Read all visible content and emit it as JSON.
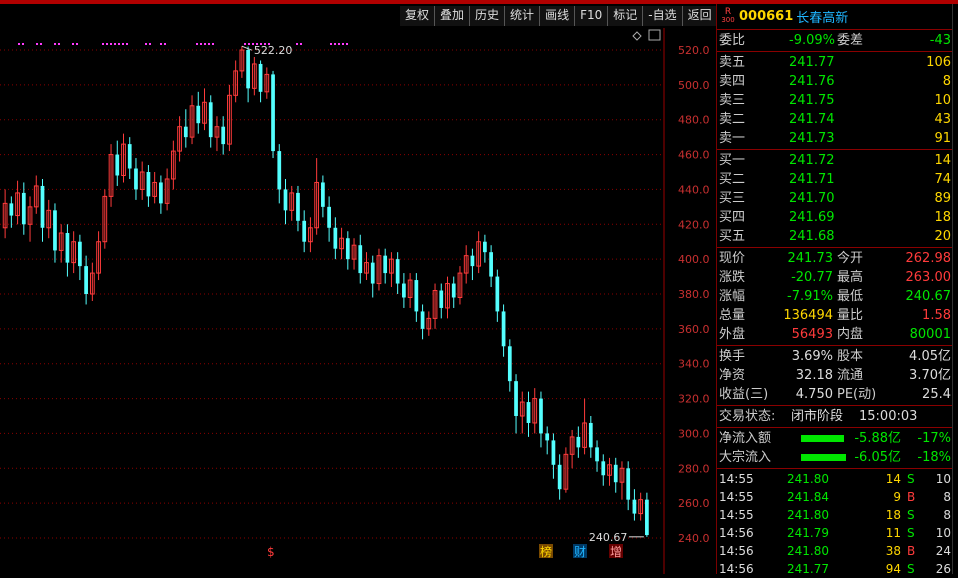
{
  "toolbar": [
    {
      "label": "复权"
    },
    {
      "label": "叠加"
    },
    {
      "label": "历史"
    },
    {
      "label": "统计"
    },
    {
      "label": "画线"
    },
    {
      "label": "F10"
    },
    {
      "label": "标记"
    },
    {
      "label": "-自选"
    },
    {
      "label": "返回"
    }
  ],
  "stock": {
    "badge_top": "R",
    "badge_bottom": "300",
    "code": "000661",
    "name": "长春高新"
  },
  "weibi": {
    "label": "委比",
    "value": "-9.09%",
    "label2": "委差",
    "value2": "-43"
  },
  "asks": [
    {
      "label": "卖五",
      "price": "241.77",
      "vol": "106"
    },
    {
      "label": "卖四",
      "price": "241.76",
      "vol": "8"
    },
    {
      "label": "卖三",
      "price": "241.75",
      "vol": "10"
    },
    {
      "label": "卖二",
      "price": "241.74",
      "vol": "43"
    },
    {
      "label": "卖一",
      "price": "241.73",
      "vol": "91"
    }
  ],
  "bids": [
    {
      "label": "买一",
      "price": "241.72",
      "vol": "14"
    },
    {
      "label": "买二",
      "price": "241.71",
      "vol": "74"
    },
    {
      "label": "买三",
      "price": "241.70",
      "vol": "89"
    },
    {
      "label": "买四",
      "price": "241.69",
      "vol": "18"
    },
    {
      "label": "买五",
      "price": "241.68",
      "vol": "20"
    }
  ],
  "quote": [
    {
      "l1": "现价",
      "v1": "241.73",
      "l2": "今开",
      "v2": "262.98"
    },
    {
      "l1": "涨跌",
      "v1": "-20.77",
      "l2": "最高",
      "v2": "263.00"
    },
    {
      "l1": "涨幅",
      "v1": "-7.91%",
      "l2": "最低",
      "v2": "240.67"
    },
    {
      "l1": "总量",
      "v1": "136494",
      "l2": "量比",
      "v2": "1.58"
    },
    {
      "l1": "外盘",
      "v1": "56493",
      "l2": "内盘",
      "v2": "80001"
    }
  ],
  "fundamentals": [
    {
      "l1": "换手",
      "v1": "3.69%",
      "l2": "股本",
      "v2": "4.05亿"
    },
    {
      "l1": "净资",
      "v1": "32.18",
      "l2": "流通",
      "v2": "3.70亿"
    },
    {
      "l1": "收益(三)",
      "v1": "4.750",
      "l2": "PE(动)",
      "v2": "25.4"
    }
  ],
  "status": {
    "label": "交易状态:",
    "phase": "闭市阶段",
    "time": "15:00:03"
  },
  "flows": [
    {
      "label": "净流入额",
      "amount": "-5.88亿",
      "pct": "-17%",
      "bar": 0.17
    },
    {
      "label": "大宗流入",
      "amount": "-6.05亿",
      "pct": "-18%",
      "bar": 0.18
    }
  ],
  "ticks": [
    {
      "time": "14:55",
      "price": "241.80",
      "vol": "14",
      "side": "S",
      "num": "10"
    },
    {
      "time": "14:55",
      "price": "241.84",
      "vol": "9",
      "side": "B",
      "num": "8"
    },
    {
      "time": "14:55",
      "price": "241.80",
      "vol": "18",
      "side": "S",
      "num": "8"
    },
    {
      "time": "14:56",
      "price": "241.79",
      "vol": "11",
      "side": "S",
      "num": "10"
    },
    {
      "time": "14:56",
      "price": "241.80",
      "vol": "38",
      "side": "B",
      "num": "24"
    },
    {
      "time": "14:56",
      "price": "241.77",
      "vol": "94",
      "side": "S",
      "num": "26"
    }
  ],
  "chart_data": {
    "type": "candlestick",
    "y_ticks": [
      "520.0",
      "500.0",
      "480.0",
      "460.0",
      "440.0",
      "420.0",
      "400.0",
      "380.0",
      "360.0",
      "340.0",
      "320.0",
      "300.0",
      "280.0",
      "260.0",
      "240.0"
    ],
    "ylim": [
      240,
      520
    ],
    "high_annotation": "522.20",
    "low_annotation": "240.67",
    "markers": [
      {
        "label": "榜"
      },
      {
        "label": "财"
      },
      {
        "label": "增"
      },
      {
        "label": "$"
      }
    ],
    "colors": {
      "up": "#ff3b3b",
      "down": "#54ffff",
      "grid": "#8a0000"
    },
    "candles": [
      [
        418,
        432,
        440,
        412
      ],
      [
        432,
        425,
        436,
        418
      ],
      [
        425,
        438,
        445,
        420
      ],
      [
        438,
        420,
        444,
        414
      ],
      [
        420,
        430,
        436,
        410
      ],
      [
        430,
        442,
        448,
        426
      ],
      [
        442,
        418,
        446,
        410
      ],
      [
        418,
        428,
        434,
        412
      ],
      [
        428,
        405,
        432,
        398
      ],
      [
        405,
        415,
        420,
        398
      ],
      [
        415,
        398,
        420,
        390
      ],
      [
        398,
        410,
        416,
        392
      ],
      [
        410,
        396,
        414,
        388
      ],
      [
        396,
        380,
        402,
        374
      ],
      [
        380,
        392,
        398,
        376
      ],
      [
        392,
        410,
        416,
        388
      ],
      [
        410,
        436,
        440,
        406
      ],
      [
        436,
        460,
        466,
        430
      ],
      [
        460,
        448,
        468,
        442
      ],
      [
        448,
        466,
        472,
        444
      ],
      [
        466,
        452,
        470,
        446
      ],
      [
        452,
        440,
        458,
        434
      ],
      [
        440,
        450,
        456,
        434
      ],
      [
        450,
        436,
        454,
        430
      ],
      [
        436,
        444,
        450,
        432
      ],
      [
        444,
        432,
        448,
        426
      ],
      [
        432,
        446,
        452,
        428
      ],
      [
        446,
        462,
        468,
        440
      ],
      [
        462,
        476,
        482,
        456
      ],
      [
        476,
        470,
        486,
        464
      ],
      [
        470,
        488,
        494,
        466
      ],
      [
        488,
        478,
        496,
        472
      ],
      [
        478,
        490,
        498,
        474
      ],
      [
        490,
        470,
        494,
        464
      ],
      [
        470,
        476,
        482,
        462
      ],
      [
        476,
        466,
        482,
        460
      ],
      [
        466,
        494,
        500,
        462
      ],
      [
        494,
        508,
        514,
        490
      ],
      [
        508,
        520,
        522.2,
        504
      ],
      [
        520,
        498,
        522,
        490
      ],
      [
        498,
        512,
        516,
        494
      ],
      [
        512,
        496,
        514,
        490
      ],
      [
        496,
        506,
        510,
        492
      ],
      [
        506,
        462,
        508,
        458
      ],
      [
        462,
        440,
        466,
        432
      ],
      [
        440,
        428,
        446,
        420
      ],
      [
        428,
        438,
        442,
        422
      ],
      [
        438,
        422,
        442,
        416
      ],
      [
        422,
        410,
        428,
        404
      ],
      [
        410,
        418,
        424,
        404
      ],
      [
        418,
        444,
        458,
        414
      ],
      [
        444,
        430,
        448,
        424
      ],
      [
        430,
        418,
        436,
        410
      ],
      [
        418,
        406,
        424,
        400
      ],
      [
        406,
        412,
        418,
        400
      ],
      [
        412,
        400,
        416,
        394
      ],
      [
        400,
        408,
        412,
        394
      ],
      [
        408,
        392,
        414,
        386
      ],
      [
        392,
        398,
        404,
        388
      ],
      [
        398,
        386,
        402,
        378
      ],
      [
        386,
        402,
        406,
        382
      ],
      [
        402,
        392,
        406,
        386
      ],
      [
        392,
        400,
        404,
        384
      ],
      [
        400,
        386,
        404,
        380
      ],
      [
        386,
        378,
        392,
        372
      ],
      [
        378,
        388,
        392,
        372
      ],
      [
        388,
        370,
        392,
        364
      ],
      [
        370,
        360,
        374,
        354
      ],
      [
        360,
        366,
        370,
        356
      ],
      [
        366,
        382,
        386,
        360
      ],
      [
        382,
        372,
        386,
        366
      ],
      [
        372,
        386,
        390,
        366
      ],
      [
        386,
        378,
        390,
        372
      ],
      [
        378,
        392,
        396,
        374
      ],
      [
        392,
        402,
        408,
        386
      ],
      [
        402,
        396,
        406,
        388
      ],
      [
        396,
        410,
        416,
        392
      ],
      [
        410,
        404,
        414,
        398
      ],
      [
        404,
        390,
        408,
        384
      ],
      [
        390,
        370,
        394,
        364
      ],
      [
        370,
        350,
        374,
        344
      ],
      [
        350,
        330,
        354,
        324
      ],
      [
        330,
        310,
        334,
        300
      ],
      [
        310,
        318,
        324,
        300
      ],
      [
        318,
        306,
        324,
        298
      ],
      [
        306,
        320,
        326,
        300
      ],
      [
        320,
        300,
        324,
        292
      ],
      [
        300,
        296,
        304,
        288
      ],
      [
        296,
        282,
        300,
        274
      ],
      [
        282,
        268,
        288,
        262
      ],
      [
        268,
        288,
        292,
        266
      ],
      [
        288,
        298,
        302,
        280
      ],
      [
        298,
        292,
        304,
        286
      ],
      [
        292,
        306,
        320,
        288
      ],
      [
        306,
        292,
        310,
        286
      ],
      [
        292,
        284,
        296,
        278
      ],
      [
        284,
        276,
        288,
        270
      ],
      [
        276,
        282,
        286,
        270
      ],
      [
        282,
        272,
        286,
        266
      ],
      [
        272,
        280,
        284,
        262
      ],
      [
        280,
        262,
        284,
        256
      ],
      [
        262,
        254,
        268,
        250
      ],
      [
        254,
        262,
        266,
        250
      ],
      [
        262,
        241.7,
        266,
        240.67
      ]
    ]
  }
}
